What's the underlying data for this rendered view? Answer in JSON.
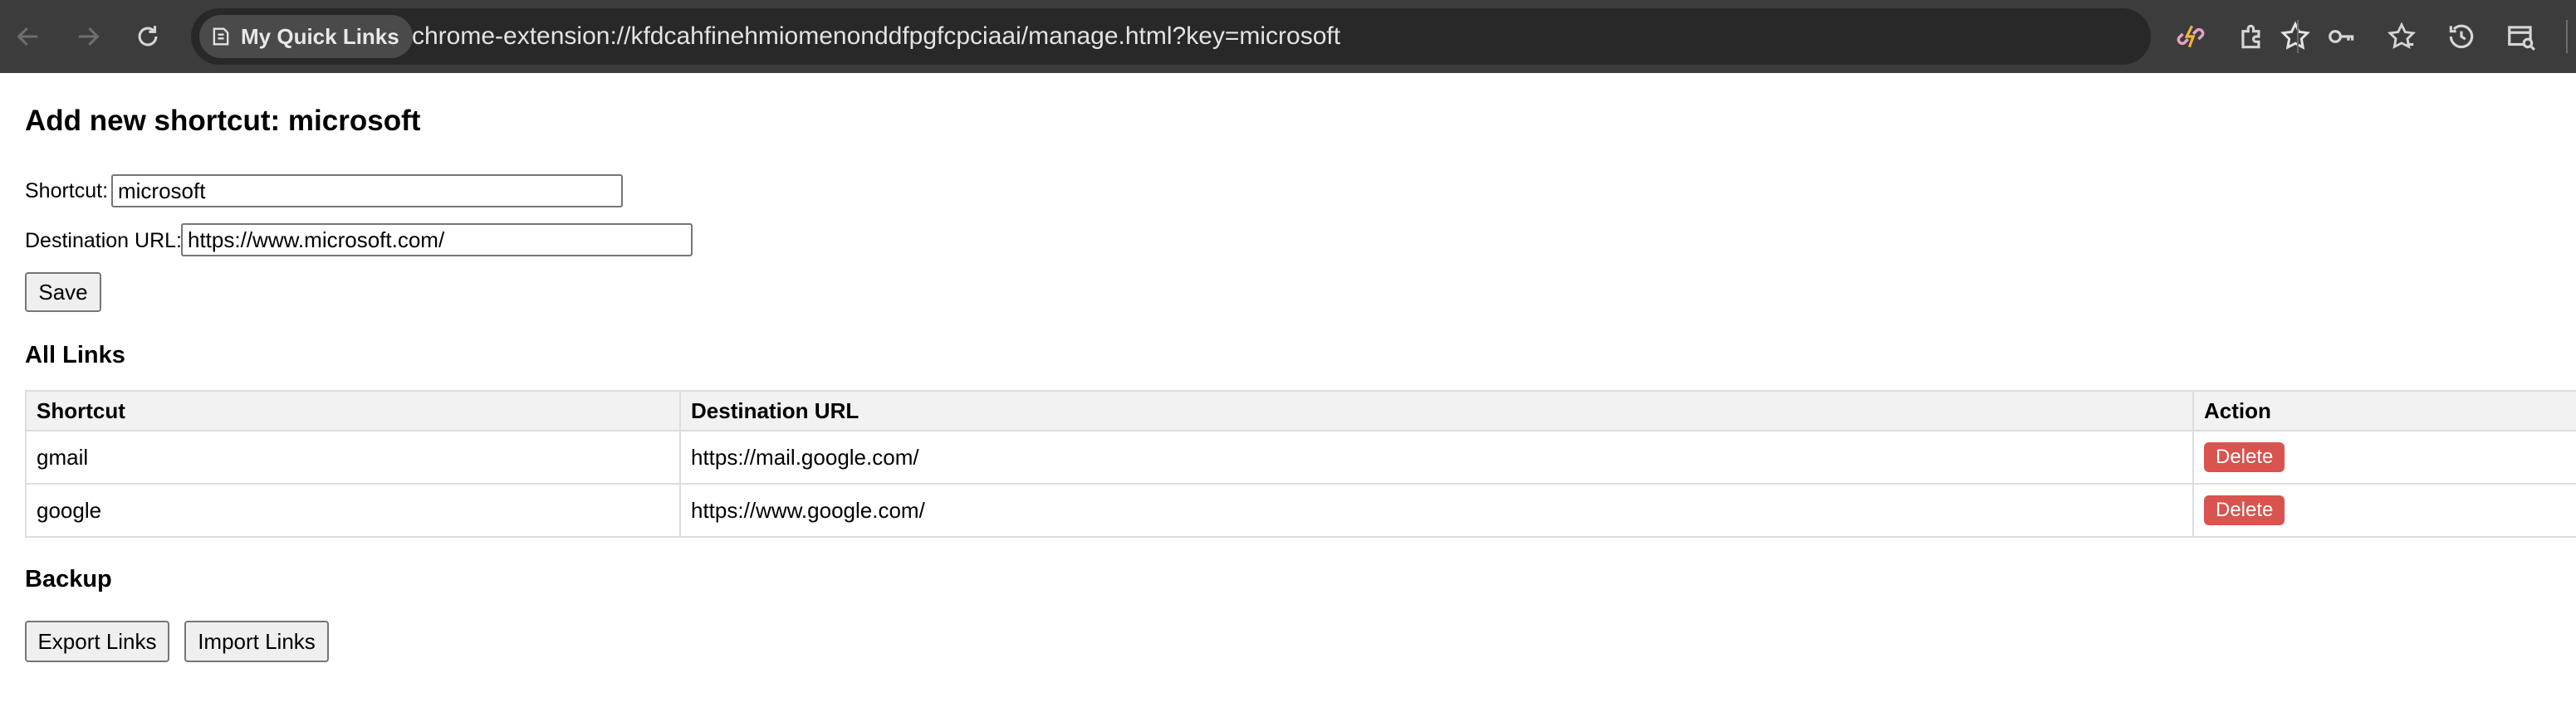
{
  "browser": {
    "extension_chip": "My Quick Links",
    "url": "chrome-extension://kfdcahfinehmiomenonddfpgfcpciaai/manage.html?key=microsoft",
    "icons": [
      "back-icon",
      "forward-icon",
      "reload-icon",
      "extension-page-icon",
      "bookmark-star-icon",
      "quick-links-extension-icon",
      "extensions-puzzle-icon",
      "password-key-icon",
      "bookmarks-star-icon",
      "history-icon",
      "side-panel-icon"
    ]
  },
  "form": {
    "title": "Add new shortcut: microsoft",
    "shortcut_label": "Shortcut:",
    "shortcut_value": "microsoft",
    "destination_label": "Destination URL:",
    "destination_value": "https://www.microsoft.com/",
    "save_label": "Save"
  },
  "links_section": {
    "heading": "All Links",
    "columns": [
      "Shortcut",
      "Destination URL",
      "Action"
    ],
    "rows": [
      {
        "shortcut": "gmail",
        "url": "https://mail.google.com/",
        "action": "Delete"
      },
      {
        "shortcut": "google",
        "url": "https://www.google.com/",
        "action": "Delete"
      }
    ]
  },
  "backup": {
    "heading": "Backup",
    "export_label": "Export Links",
    "import_label": "Import Links"
  },
  "colors": {
    "toolbar_bg": "#3c3c3c",
    "omnibox_bg": "#282828",
    "delete_button": "#d9534f",
    "table_header_bg": "#f2f2f2"
  }
}
